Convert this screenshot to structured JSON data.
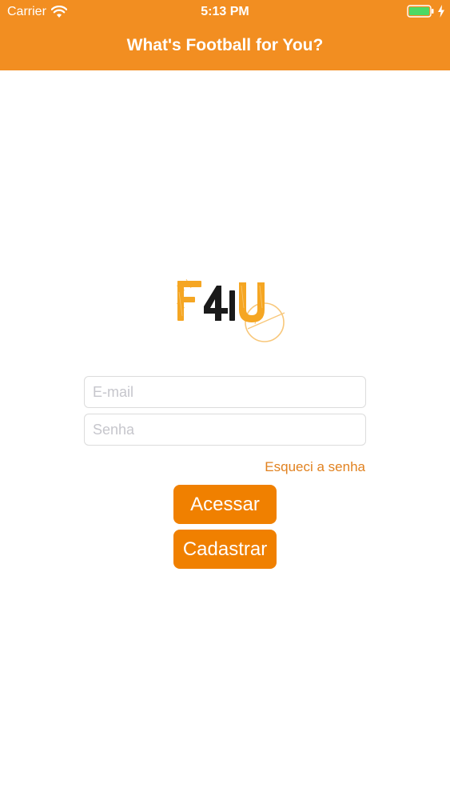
{
  "status_bar": {
    "carrier": "Carrier",
    "time": "5:13 PM",
    "wifi_icon": "wifi-icon",
    "battery_icon": "battery-icon",
    "charging_icon": "bolt-icon"
  },
  "nav": {
    "title": "What's Football for You?"
  },
  "logo": {
    "text": "F4U"
  },
  "form": {
    "email_placeholder": "E-mail",
    "email_value": "",
    "password_placeholder": "Senha",
    "password_value": "",
    "forgot_label": "Esqueci a senha",
    "login_label": "Acessar",
    "register_label": "Cadastrar"
  },
  "colors": {
    "nav_bar": "#F28E21",
    "button": "#F08000",
    "link": "#E18220",
    "logo_orange": "#F5A623",
    "logo_dark": "#1a1a1a"
  }
}
